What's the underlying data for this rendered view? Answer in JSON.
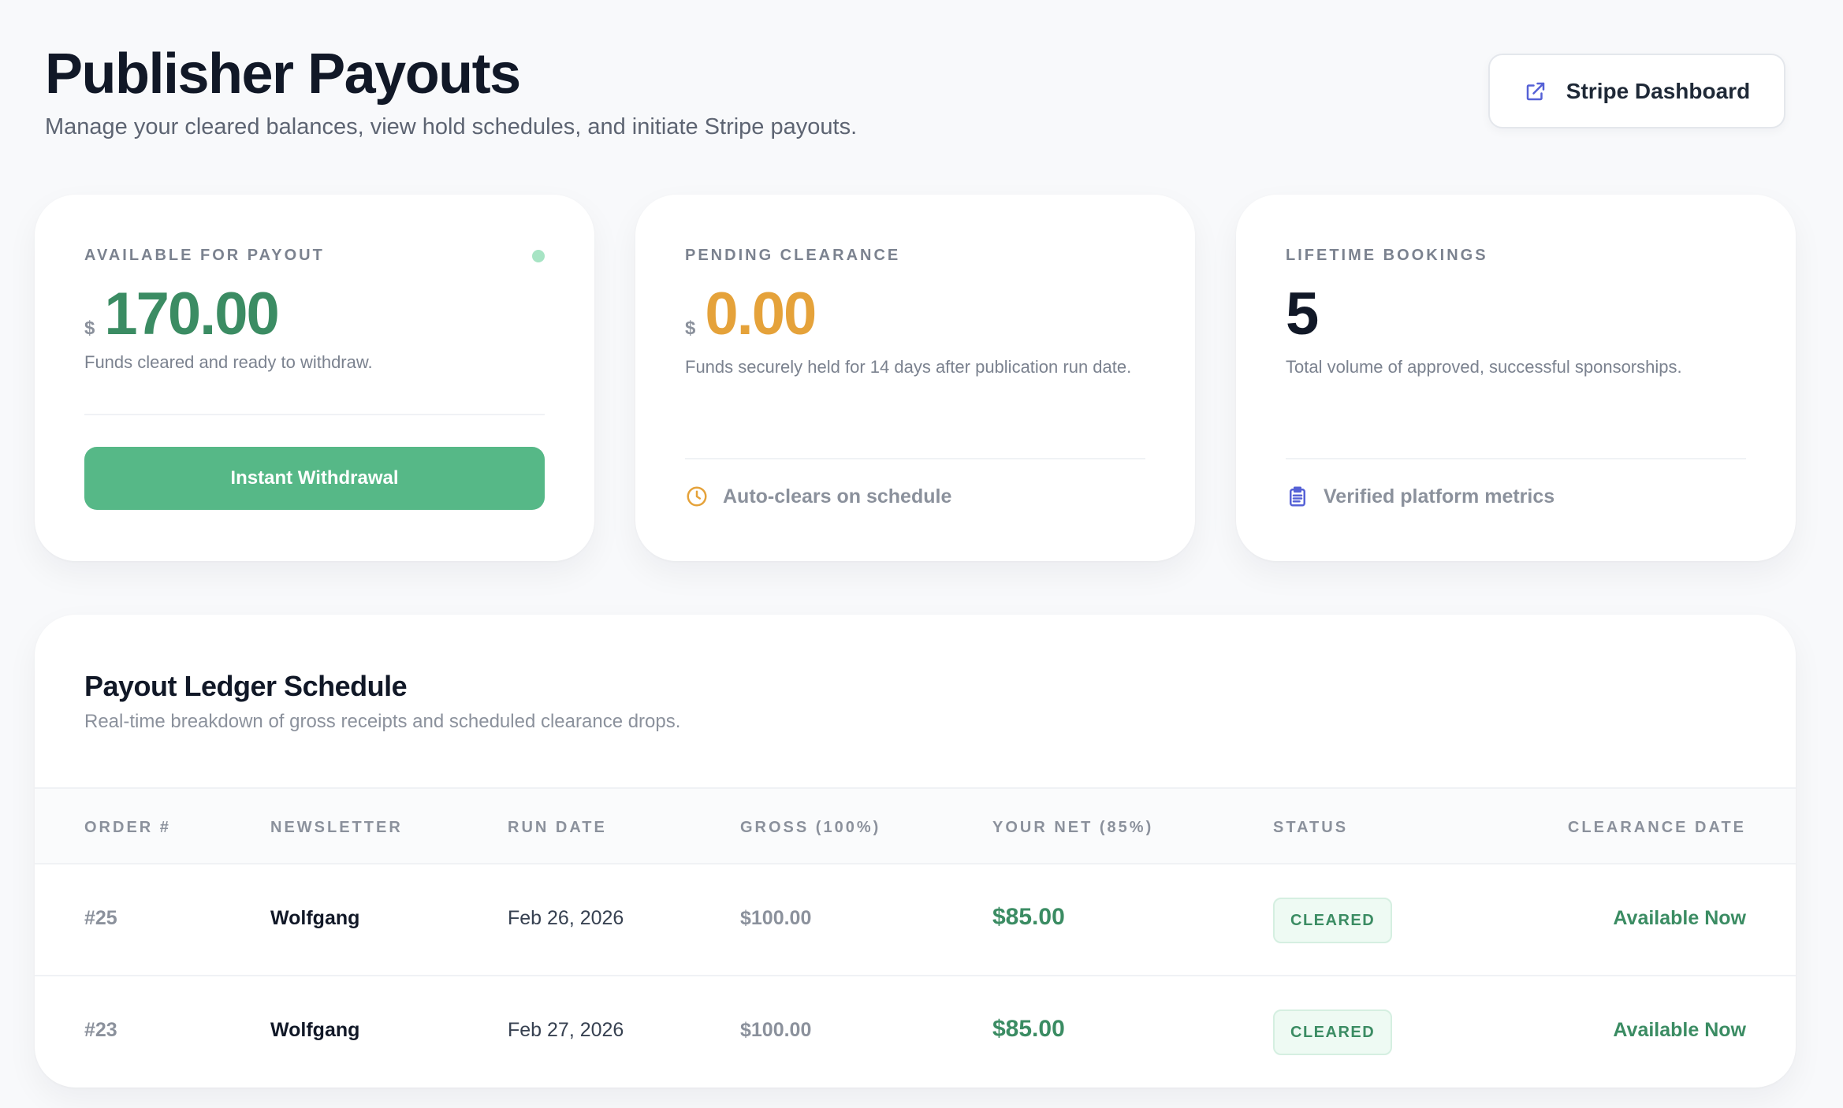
{
  "header": {
    "title": "Publisher Payouts",
    "subtitle": "Manage your cleared balances, view hold schedules, and initiate Stripe payouts.",
    "stripe_button": {
      "label": "Stripe Dashboard",
      "icon": "external-link-icon"
    }
  },
  "cards": {
    "available": {
      "label": "AVAILABLE FOR PAYOUT",
      "currency": "$",
      "amount": "170.00",
      "description": "Funds cleared and ready to withdraw.",
      "button_label": "Instant Withdrawal",
      "status_dot_color": "#a7e4c4",
      "accent": "#3b8c63"
    },
    "pending": {
      "label": "PENDING CLEARANCE",
      "currency": "$",
      "amount": "0.00",
      "description": "Funds securely held for 14 days after publication run date.",
      "footer_text": "Auto-clears on schedule",
      "footer_icon": "clock-icon",
      "accent": "#e5a23a"
    },
    "lifetime": {
      "label": "LIFETIME BOOKINGS",
      "amount": "5",
      "description": "Total volume of approved, successful sponsorships.",
      "footer_text": "Verified platform metrics",
      "footer_icon": "clipboard-icon"
    }
  },
  "ledger": {
    "title": "Payout Ledger Schedule",
    "subtitle": "Real-time breakdown of gross receipts and scheduled clearance drops.",
    "columns": [
      "ORDER #",
      "NEWSLETTER",
      "RUN DATE",
      "GROSS (100%)",
      "YOUR NET (85%)",
      "STATUS",
      "CLEARANCE DATE"
    ],
    "rows": [
      {
        "order": "#25",
        "newsletter": "Wolfgang",
        "run_date": "Feb 26, 2026",
        "gross": "$100.00",
        "net": "$85.00",
        "status": "CLEARED",
        "clearance": "Available Now"
      },
      {
        "order": "#23",
        "newsletter": "Wolfgang",
        "run_date": "Feb 27, 2026",
        "gross": "$100.00",
        "net": "$85.00",
        "status": "CLEARED",
        "clearance": "Available Now"
      }
    ]
  }
}
